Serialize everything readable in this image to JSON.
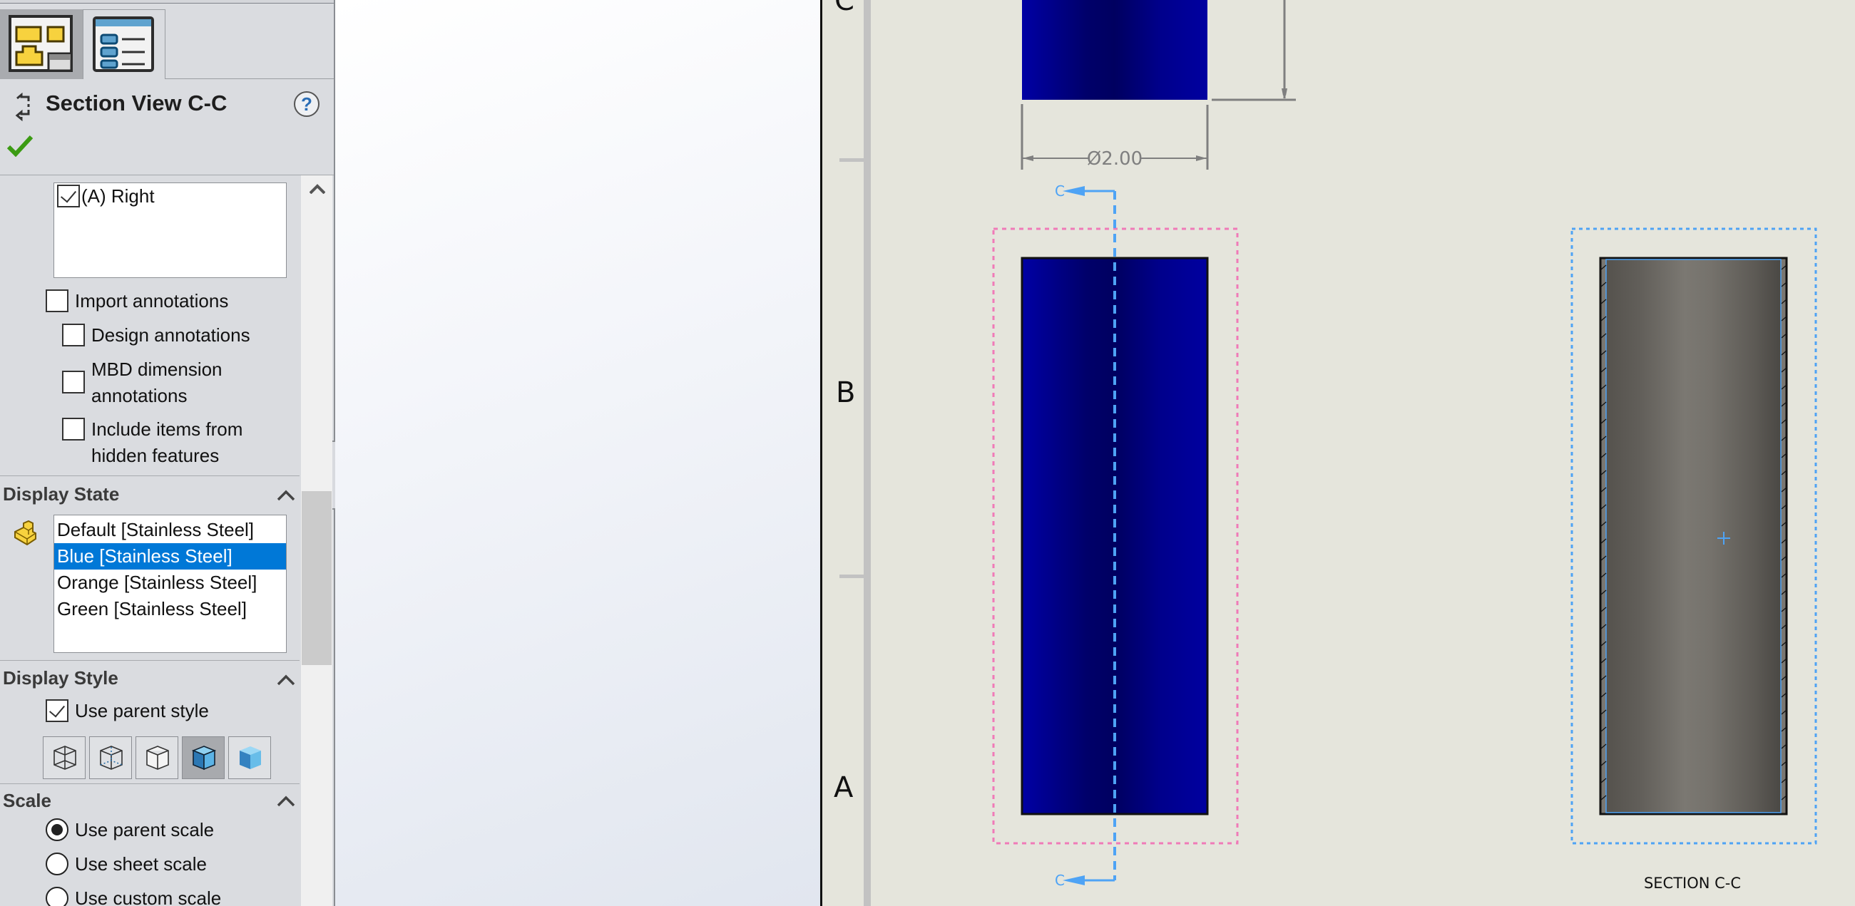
{
  "panel": {
    "tabs": [
      {
        "name": "FeatureManager Design Tree",
        "icon": "feature-manager-icon",
        "active": true
      },
      {
        "name": "PropertyManager",
        "icon": "property-manager-icon",
        "active": false
      }
    ],
    "title": "Section View C-C",
    "title_icon": "section-view-icon",
    "help_label": "?",
    "ok_icon": "checkmark-icon",
    "views_list": [
      {
        "label": "(A) Right",
        "checked": true
      }
    ],
    "annotation_options": [
      {
        "label": "Import annotations",
        "checked": false,
        "indent": 0
      },
      {
        "label": "Design annotations",
        "checked": false,
        "indent": 1
      },
      {
        "label": "MBD dimension annotations",
        "line1": "MBD dimension",
        "line2": "annotations",
        "checked": false,
        "indent": 1
      },
      {
        "label": "Include items from hidden features",
        "line1": "Include items from",
        "line2": "hidden features",
        "checked": false,
        "indent": 1
      }
    ],
    "display_state": {
      "title": "Display State",
      "icon": "display-state-icon",
      "options": [
        "Default [Stainless Steel]",
        "Blue [Stainless Steel]",
        "Orange [Stainless Steel]",
        "Green [Stainless Steel]"
      ],
      "selected": "Blue [Stainless Steel]"
    },
    "display_style": {
      "title": "Display Style",
      "use_parent_label": "Use parent style",
      "use_parent_checked": true,
      "buttons": [
        "Wireframe",
        "Hidden Lines Visible",
        "Hidden Lines Removed",
        "Shaded With Edges",
        "Shaded"
      ],
      "active": "Shaded With Edges"
    },
    "scale": {
      "title": "Scale",
      "options": [
        "Use parent scale",
        "Use sheet scale",
        "Use custom scale"
      ],
      "selected": "Use parent scale"
    }
  },
  "drawing": {
    "zones": [
      "C",
      "B",
      "A"
    ],
    "dimension_label": "Ø2.00",
    "section_letter": "C",
    "section_label": "SECTION C-C",
    "colors": {
      "sheet": "#e5e5dc",
      "part_blue": "#00008c",
      "section_line": "#4ea3f5",
      "view_border_selected": "#f07ab8",
      "section_view_border": "#4ea3f5",
      "dimension": "#7f7f7f",
      "section_gray": "#6b6863"
    }
  }
}
